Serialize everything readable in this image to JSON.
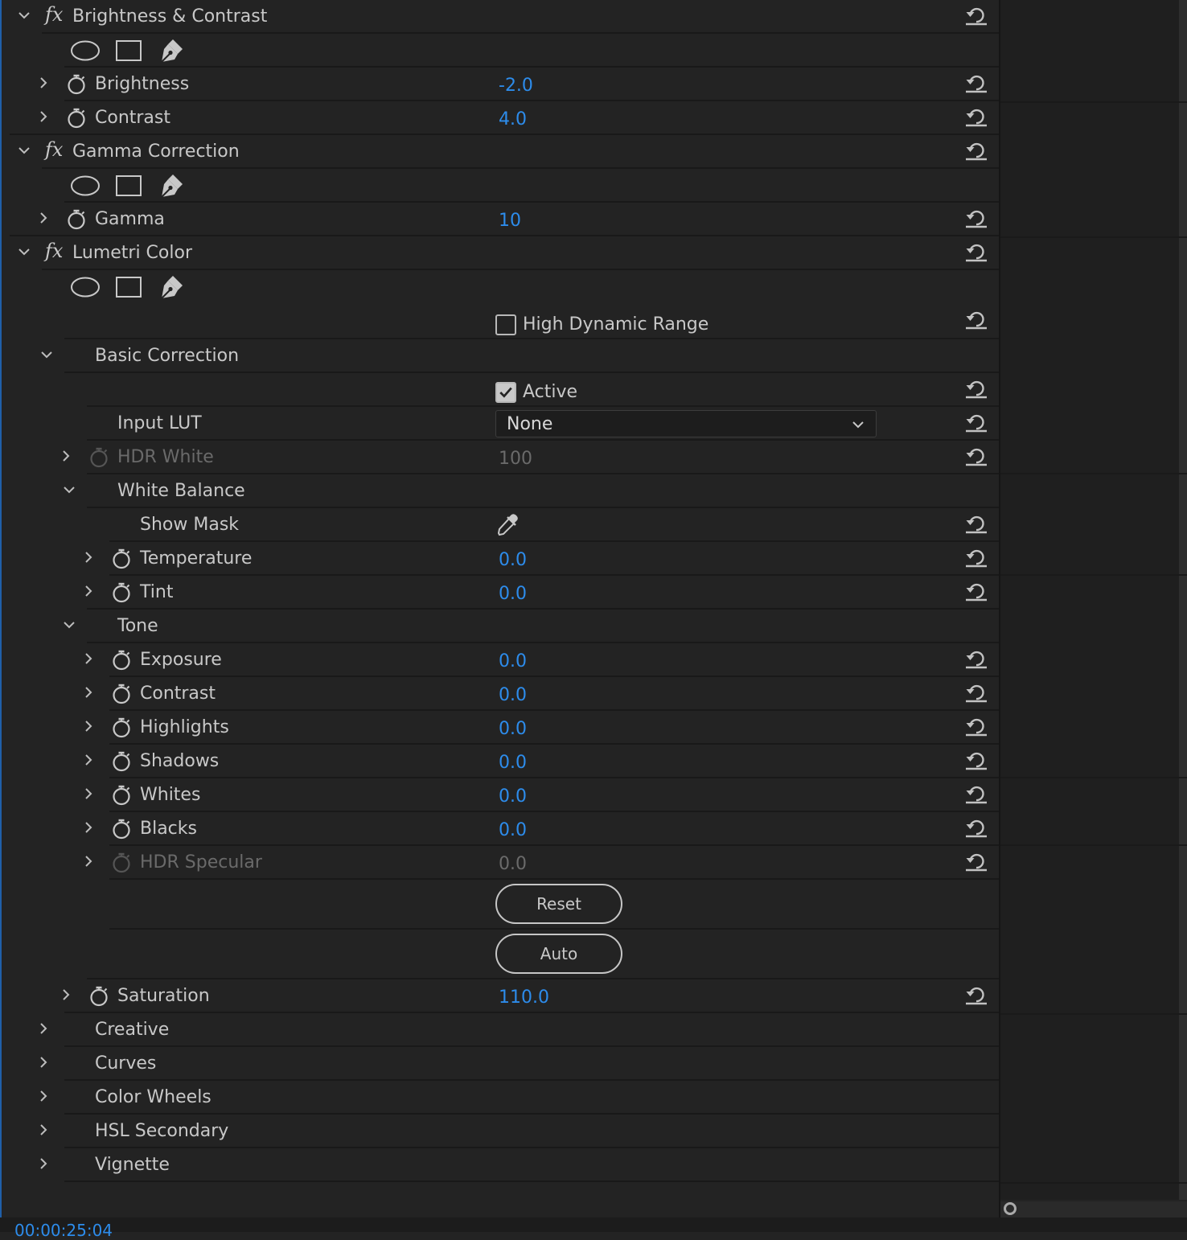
{
  "effects": {
    "brightness_contrast": {
      "title": "Brightness & Contrast",
      "params": {
        "brightness": {
          "label": "Brightness",
          "value": "-2.0"
        },
        "contrast": {
          "label": "Contrast",
          "value": "4.0"
        }
      }
    },
    "gamma_correction": {
      "title": "Gamma Correction",
      "params": {
        "gamma": {
          "label": "Gamma",
          "value": "10"
        }
      }
    },
    "lumetri": {
      "title": "Lumetri Color",
      "hdr_label": "High Dynamic Range",
      "hdr_checked": false,
      "basic": {
        "title": "Basic Correction",
        "active_label": "Active",
        "active_checked": true,
        "input_lut": {
          "label": "Input LUT",
          "value": "None"
        },
        "hdr_white": {
          "label": "HDR White",
          "value": "100"
        },
        "white_balance": {
          "title": "White Balance",
          "show_mask": "Show Mask",
          "temperature": {
            "label": "Temperature",
            "value": "0.0"
          },
          "tint": {
            "label": "Tint",
            "value": "0.0"
          }
        },
        "tone": {
          "title": "Tone",
          "exposure": {
            "label": "Exposure",
            "value": "0.0"
          },
          "contrast": {
            "label": "Contrast",
            "value": "0.0"
          },
          "highlights": {
            "label": "Highlights",
            "value": "0.0"
          },
          "shadows": {
            "label": "Shadows",
            "value": "0.0"
          },
          "whites": {
            "label": "Whites",
            "value": "0.0"
          },
          "blacks": {
            "label": "Blacks",
            "value": "0.0"
          },
          "hdr_specular": {
            "label": "HDR Specular",
            "value": "0.0"
          }
        },
        "reset_label": "Reset",
        "auto_label": "Auto",
        "saturation": {
          "label": "Saturation",
          "value": "110.0"
        }
      },
      "sections": {
        "creative": "Creative",
        "curves": "Curves",
        "color_wheels": "Color Wheels",
        "hsl_secondary": "HSL Secondary",
        "vignette": "Vignette"
      }
    }
  },
  "timecode": "00:00:25:04",
  "colors": {
    "value_blue": "#2d8ceb",
    "panel_bg": "#232323",
    "text": "#c8c8c8",
    "disabled": "#6a6a6a"
  },
  "icons": [
    "chevron-down-icon",
    "chevron-right-icon",
    "fx-icon",
    "stopwatch-icon",
    "reset-icon",
    "ellipse-mask-icon",
    "rectangle-mask-icon",
    "pen-mask-icon",
    "eyedropper-icon",
    "checkbox-icon",
    "dropdown-chevron-icon",
    "playhead-icon"
  ]
}
